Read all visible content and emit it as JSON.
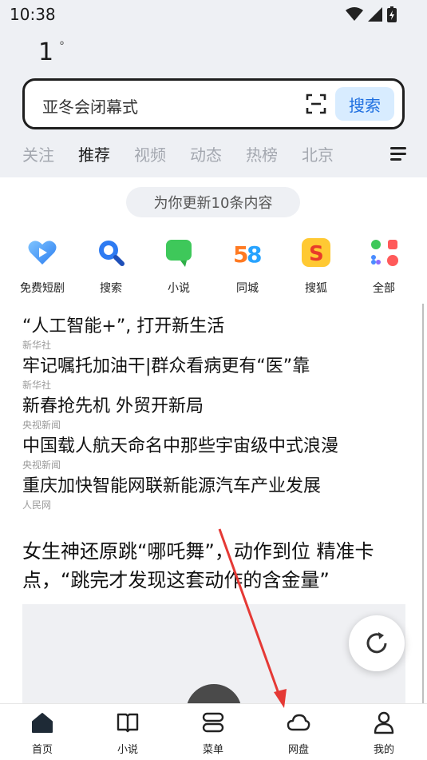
{
  "status": {
    "time": "10:38"
  },
  "weather": {
    "temperature": "1",
    "unit": "°"
  },
  "search": {
    "query": "亚冬会闭幕式",
    "button_label": "搜索"
  },
  "tabs": [
    {
      "label": "关注"
    },
    {
      "label": "推荐"
    },
    {
      "label": "视频"
    },
    {
      "label": "动态"
    },
    {
      "label": "热榜"
    },
    {
      "label": "北京"
    }
  ],
  "update_notice": "为你更新10条内容",
  "apps": [
    {
      "label": "免费短剧",
      "icon": "heart-play-icon"
    },
    {
      "label": "搜索",
      "icon": "search-icon"
    },
    {
      "label": "小说",
      "icon": "chat-bubble-icon"
    },
    {
      "label": "同城",
      "icon": "58-icon"
    },
    {
      "label": "搜狐",
      "icon": "sohu-icon"
    },
    {
      "label": "全部",
      "icon": "grid-icon"
    }
  ],
  "news": [
    {
      "title": "“人工智能+”, 打开新生活",
      "source": "新华社"
    },
    {
      "title": "牢记嘱托加油干|群众看病更有“医”靠",
      "source": "新华社"
    },
    {
      "title": "新春抢先机 外贸开新局",
      "source": "央视新闻"
    },
    {
      "title": "中国载人航天命名中那些宇宙级中式浪漫",
      "source": "央视新闻"
    },
    {
      "title": "重庆加快智能网联新能源汽车产业发展",
      "source": "人民网"
    }
  ],
  "feature": {
    "line1": "女生神还原跳“哪吒舞”，动作到位 精准卡",
    "line2": "点，“跳完才发现这套动作的含金量”"
  },
  "bottom_nav": [
    {
      "label": "首页",
      "icon": "home-icon"
    },
    {
      "label": "小说",
      "icon": "book-icon"
    },
    {
      "label": "菜单",
      "icon": "menu-icon"
    },
    {
      "label": "网盘",
      "icon": "cloud-icon"
    },
    {
      "label": "我的",
      "icon": "profile-icon"
    }
  ],
  "colors": {
    "accent": "#1f6fe0",
    "annotation": "#e53935"
  }
}
